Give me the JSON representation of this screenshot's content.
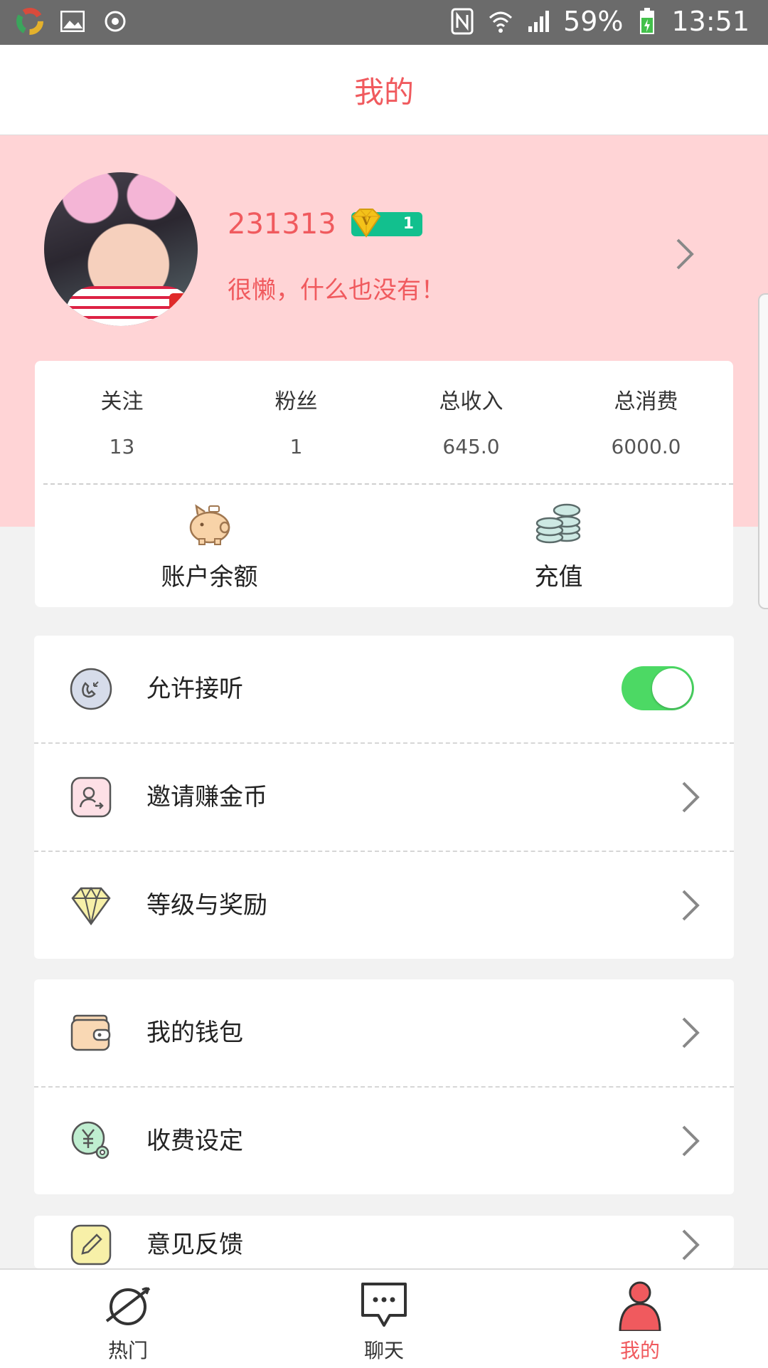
{
  "status_bar": {
    "battery": "59%",
    "time": "13:51"
  },
  "header": {
    "title": "我的"
  },
  "profile": {
    "username": "231313",
    "vip_level": "1",
    "bio": "很懒，什么也没有！"
  },
  "stats": [
    {
      "label": "关注",
      "value": "13"
    },
    {
      "label": "粉丝",
      "value": "1"
    },
    {
      "label": "总收入",
      "value": "645.0"
    },
    {
      "label": "总消费",
      "value": "6000.0"
    }
  ],
  "actions": {
    "balance_label": "账户余额",
    "recharge_label": "充值"
  },
  "menu_group_1": {
    "allow_answer": "允许接听",
    "allow_answer_on": true,
    "invite": "邀请赚金币",
    "level": "等级与奖励"
  },
  "menu_group_2": {
    "wallet": "我的钱包",
    "fee": "收费设定"
  },
  "menu_group_3": {
    "feedback": "意见反馈"
  },
  "bottom_nav": {
    "hot": "热门",
    "chat": "聊天",
    "mine": "我的"
  },
  "colors": {
    "accent": "#f05a5e",
    "header_bg": "#ffd4d6",
    "toggle_on": "#4cd964",
    "vip": "#12c08e"
  }
}
